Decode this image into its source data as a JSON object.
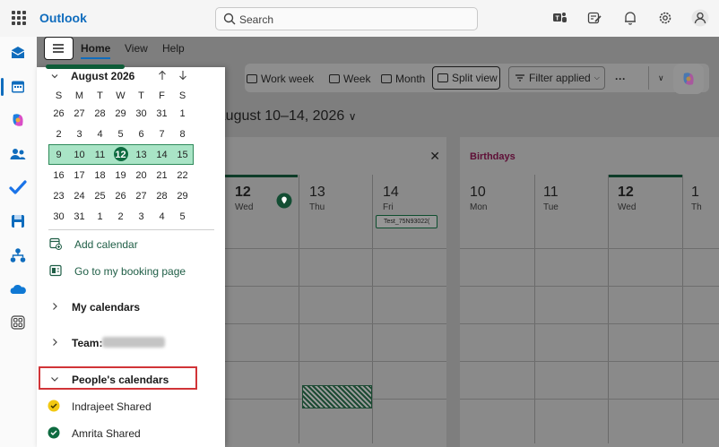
{
  "app": {
    "name": "Outlook"
  },
  "search": {
    "placeholder": "Search"
  },
  "ribbon": {
    "tabs": [
      "Home",
      "View",
      "Help"
    ]
  },
  "toolbar": {
    "work_week": "Work week",
    "week": "Week",
    "month": "Month",
    "split_view": "Split view",
    "filter": "Filter applied",
    "more": "···"
  },
  "calendar": {
    "date_range": "August 10–14, 2026",
    "pane1_days": [
      {
        "num": "12",
        "name": "Wed"
      },
      {
        "num": "13",
        "name": "Thu"
      },
      {
        "num": "14",
        "name": "Fri"
      }
    ],
    "pane2_title": "Birthdays",
    "pane2_days": [
      {
        "num": "10",
        "name": "Mon"
      },
      {
        "num": "11",
        "name": "Tue"
      },
      {
        "num": "12",
        "name": "Wed"
      },
      {
        "num": "1",
        "name": "Th"
      }
    ],
    "event_label": "Test_75N93022("
  },
  "mini_calendar": {
    "title": "August 2026",
    "weekdays": [
      "S",
      "M",
      "T",
      "W",
      "T",
      "F",
      "S"
    ],
    "weeks": [
      [
        "26",
        "27",
        "28",
        "29",
        "30",
        "31",
        "1"
      ],
      [
        "2",
        "3",
        "4",
        "5",
        "6",
        "7",
        "8"
      ],
      [
        "9",
        "10",
        "11",
        "12",
        "13",
        "14",
        "15"
      ],
      [
        "16",
        "17",
        "18",
        "19",
        "20",
        "21",
        "22"
      ],
      [
        "23",
        "24",
        "25",
        "26",
        "27",
        "28",
        "29"
      ],
      [
        "30",
        "31",
        "1",
        "2",
        "3",
        "4",
        "5"
      ]
    ]
  },
  "sidebar": {
    "add_calendar": "Add calendar",
    "booking_page": "Go to my booking page",
    "my_calendars": "My calendars",
    "team_label": "Team:",
    "peoples_calendars": "People's calendars",
    "shared": [
      "Indrajeet Shared",
      "Amrita Shared"
    ]
  },
  "colors": {
    "accent": "#0f6cbd",
    "calendar_green": "#0e6b40",
    "highlight_red": "#d13438"
  }
}
